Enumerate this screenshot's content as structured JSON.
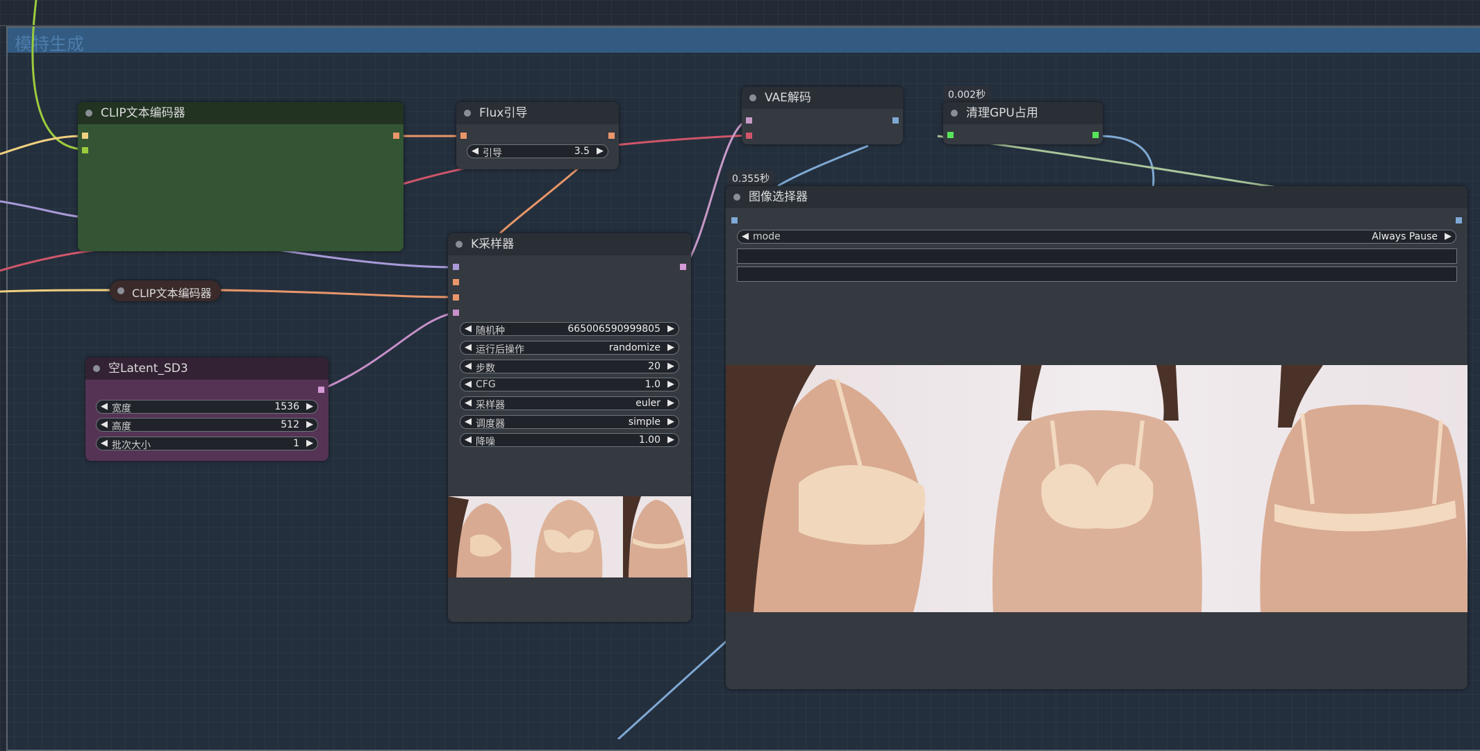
{
  "group": {
    "title": "模特生成"
  },
  "nodes": {
    "clip1": {
      "title": "CLIP文本编码器"
    },
    "clip2": {
      "title": "CLIP文本编码器"
    },
    "flux": {
      "title": "Flux引导",
      "widgets": [
        {
          "label": "引导",
          "value": "3.5"
        }
      ]
    },
    "vae": {
      "title": "VAE解码"
    },
    "gpu": {
      "title": "清理GPU占用",
      "badge": "0.002秒"
    },
    "latent": {
      "title": "空Latent_SD3",
      "widgets": [
        {
          "label": "宽度",
          "value": "1536"
        },
        {
          "label": "高度",
          "value": "512"
        },
        {
          "label": "批次大小",
          "value": "1"
        }
      ]
    },
    "ksampler": {
      "title": "K采样器",
      "widgets": [
        {
          "label": "随机种",
          "value": "665006590999805"
        },
        {
          "label": "运行后操作",
          "value": "randomize"
        },
        {
          "label": "步数",
          "value": "20"
        },
        {
          "label": "CFG",
          "value": "1.0"
        },
        {
          "label": "采样器",
          "value": "euler"
        },
        {
          "label": "调度器",
          "value": "simple"
        },
        {
          "label": "降噪",
          "value": "1.00"
        }
      ]
    },
    "selector": {
      "title": "图像选择器",
      "badge": "0.355秒",
      "widgets": [
        {
          "label": "mode",
          "value": "Always Pause"
        }
      ]
    }
  },
  "colors": {
    "background": "#222a35",
    "group_header": "#335a80",
    "clip_node": "#335533",
    "latent_node": "#553355",
    "node_body": "#353940",
    "link_clip": "#f0d080",
    "link_conditioning": "#e8966a",
    "link_model": "#b39ddb",
    "link_latent": "#d59ad6",
    "link_vae": "#d0566b",
    "link_image": "#7fa9d4",
    "slot_green": "#58e45a"
  },
  "icons": {
    "node_status": "node-status-dot-icon",
    "arrow_left": "arrow-left-icon",
    "arrow_right": "arrow-right-icon"
  }
}
